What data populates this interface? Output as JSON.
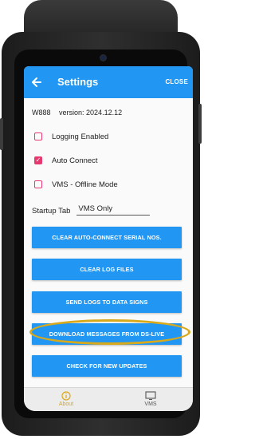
{
  "app": {
    "title": "Settings",
    "close_label": "CLOSE"
  },
  "info": {
    "device": "W888",
    "version": "version: 2024.12.12"
  },
  "options": [
    {
      "label": "Logging Enabled",
      "checked": false
    },
    {
      "label": "Auto Connect",
      "checked": true
    },
    {
      "label": "VMS - Offline Mode",
      "checked": false
    }
  ],
  "startup_tab": {
    "label": "Startup Tab",
    "value": "VMS Only"
  },
  "buttons": {
    "clear_autoconnect": "CLEAR AUTO-CONNECT SERIAL NOS.",
    "clear_logs": "CLEAR LOG FILES",
    "send_logs": "SEND LOGS TO DATA SIGNS",
    "download_messages": "DOWNLOAD MESSAGES FROM DS-LIVE",
    "check_updates": "CHECK FOR NEW UPDATES"
  },
  "bottom_nav": [
    {
      "label": "About",
      "icon": "info-icon",
      "active": true
    },
    {
      "label": "VMS",
      "icon": "monitor-icon",
      "active": false
    }
  ],
  "colors": {
    "primary": "#2196F3",
    "checkbox": "#e53970",
    "highlight": "#d9a91c"
  }
}
